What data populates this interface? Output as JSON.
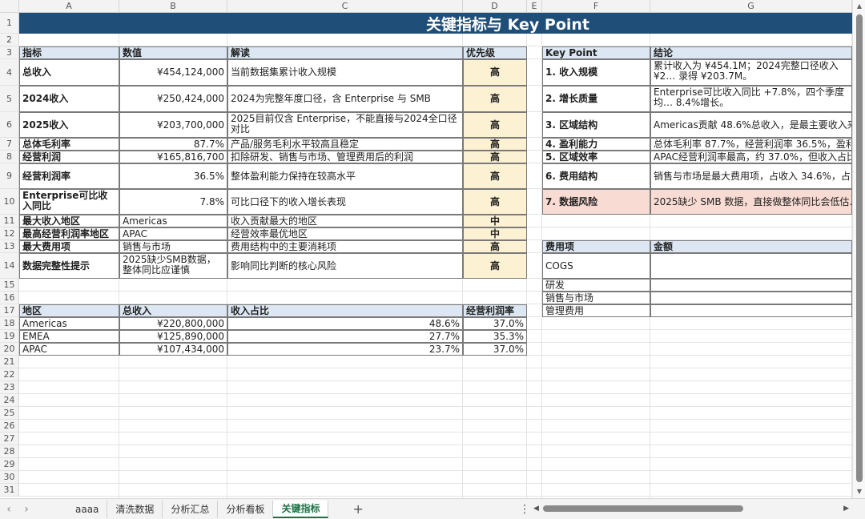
{
  "columns": [
    "A",
    "B",
    "C",
    "D",
    "E",
    "F",
    "G"
  ],
  "rows": [
    "1",
    "2",
    "3",
    "4",
    "5",
    "6",
    "7",
    "8",
    "9",
    "10",
    "11",
    "12",
    "13",
    "14",
    "15",
    "16",
    "17",
    "18",
    "19",
    "20",
    "21",
    "22",
    "23",
    "24",
    "25",
    "26",
    "27",
    "28",
    "29",
    "30",
    "31"
  ],
  "banner_title": "关键指标与 Key Point",
  "metrics_header": {
    "indicator": "指标",
    "value": "数值",
    "interpretation": "解读",
    "priority": "优先级"
  },
  "metrics": [
    {
      "indicator": "总收入",
      "value": "¥454,124,000",
      "interpretation": "当前数据集累计收入规模",
      "priority": "高"
    },
    {
      "indicator": "2024收入",
      "value": "¥250,424,000",
      "interpretation": "2024为完整年度口径，含 Enterprise 与 SMB",
      "priority": "高"
    },
    {
      "indicator": "2025收入",
      "value": "¥203,700,000",
      "interpretation": "2025目前仅含 Enterprise，不能直接与2024全口径对比",
      "priority": "高"
    },
    {
      "indicator": "总体毛利率",
      "value": "87.7%",
      "interpretation": "产品/服务毛利水平较高且稳定",
      "priority": "高"
    },
    {
      "indicator": "经营利润",
      "value": "¥165,816,700",
      "interpretation": "扣除研发、销售与市场、管理费用后的利润",
      "priority": "高"
    },
    {
      "indicator": "经营利润率",
      "value": "36.5%",
      "interpretation": "整体盈利能力保持在较高水平",
      "priority": "高"
    },
    {
      "indicator": "Enterprise可比收入同比",
      "value": "7.8%",
      "interpretation": "可比口径下的收入增长表现",
      "priority": "高"
    },
    {
      "indicator": "最大收入地区",
      "value": "Americas",
      "interpretation": "收入贡献最大的地区",
      "priority": "中"
    },
    {
      "indicator": "最高经营利润率地区",
      "value": "APAC",
      "interpretation": "经营效率最优地区",
      "priority": "中"
    },
    {
      "indicator": "最大费用项",
      "value": "销售与市场",
      "interpretation": "费用结构中的主要消耗项",
      "priority": "高"
    },
    {
      "indicator": "数据完整性提示",
      "value": "2025缺少SMB数据，整体同比应谨慎",
      "interpretation": "影响同比判断的核心风险",
      "priority": "高"
    }
  ],
  "region_header": {
    "region": "地区",
    "revenue": "总收入",
    "share": "收入占比",
    "margin": "经营利润率"
  },
  "regions": [
    {
      "region": "Americas",
      "revenue": "¥220,800,000",
      "share": "48.6%",
      "margin": "37.0%"
    },
    {
      "region": "EMEA",
      "revenue": "¥125,890,000",
      "share": "27.7%",
      "margin": "35.3%"
    },
    {
      "region": "APAC",
      "revenue": "¥107,434,000",
      "share": "23.7%",
      "margin": "37.0%"
    }
  ],
  "kp_header": {
    "key_point": "Key Point",
    "conclusion": "结论"
  },
  "key_points": [
    {
      "label": "1. 收入规模",
      "text": "累计收入为 ¥454.1M；2024完整口径收入 ¥2… 录得 ¥203.7M。"
    },
    {
      "label": "2. 增长质量",
      "text": "Enterprise可比收入同比 +7.8%，四个季度均… 8.4%增长。"
    },
    {
      "label": "3. 区域结构",
      "text": "Americas贡献 48.6%总收入，是最主要收入来…"
    },
    {
      "label": "4. 盈利能力",
      "text": "总体毛利率 87.7%，经营利润率 36.5%，盈利…"
    },
    {
      "label": "5. 区域效率",
      "text": "APAC经营利润率最高，约 37.0%，但收入占比…"
    },
    {
      "label": "6. 费用结构",
      "text": "销售与市场是最大费用项，占收入 34.6%，占…"
    },
    {
      "label": "7. 数据风险",
      "text": "2025缺少 SMB 数据，直接做整体同比会低估…"
    }
  ],
  "expense_header": {
    "item": "费用项",
    "amount": "金额"
  },
  "expenses": [
    {
      "item": "COGS"
    },
    {
      "item": "研发"
    },
    {
      "item": "销售与市场"
    },
    {
      "item": "管理费用"
    }
  ],
  "tabs": [
    "aaaa",
    "清洗数据",
    "分析汇总",
    "分析看板",
    "关键指标"
  ],
  "active_tab": "关键指标",
  "add_sheet_symbol": "+",
  "colors": {
    "banner": "#1f4e79",
    "header_fill": "#dce7f3",
    "priority_fill": "#fdf1d3",
    "risk_fill": "#f8dcd4",
    "active_tab": "#1e7145"
  }
}
